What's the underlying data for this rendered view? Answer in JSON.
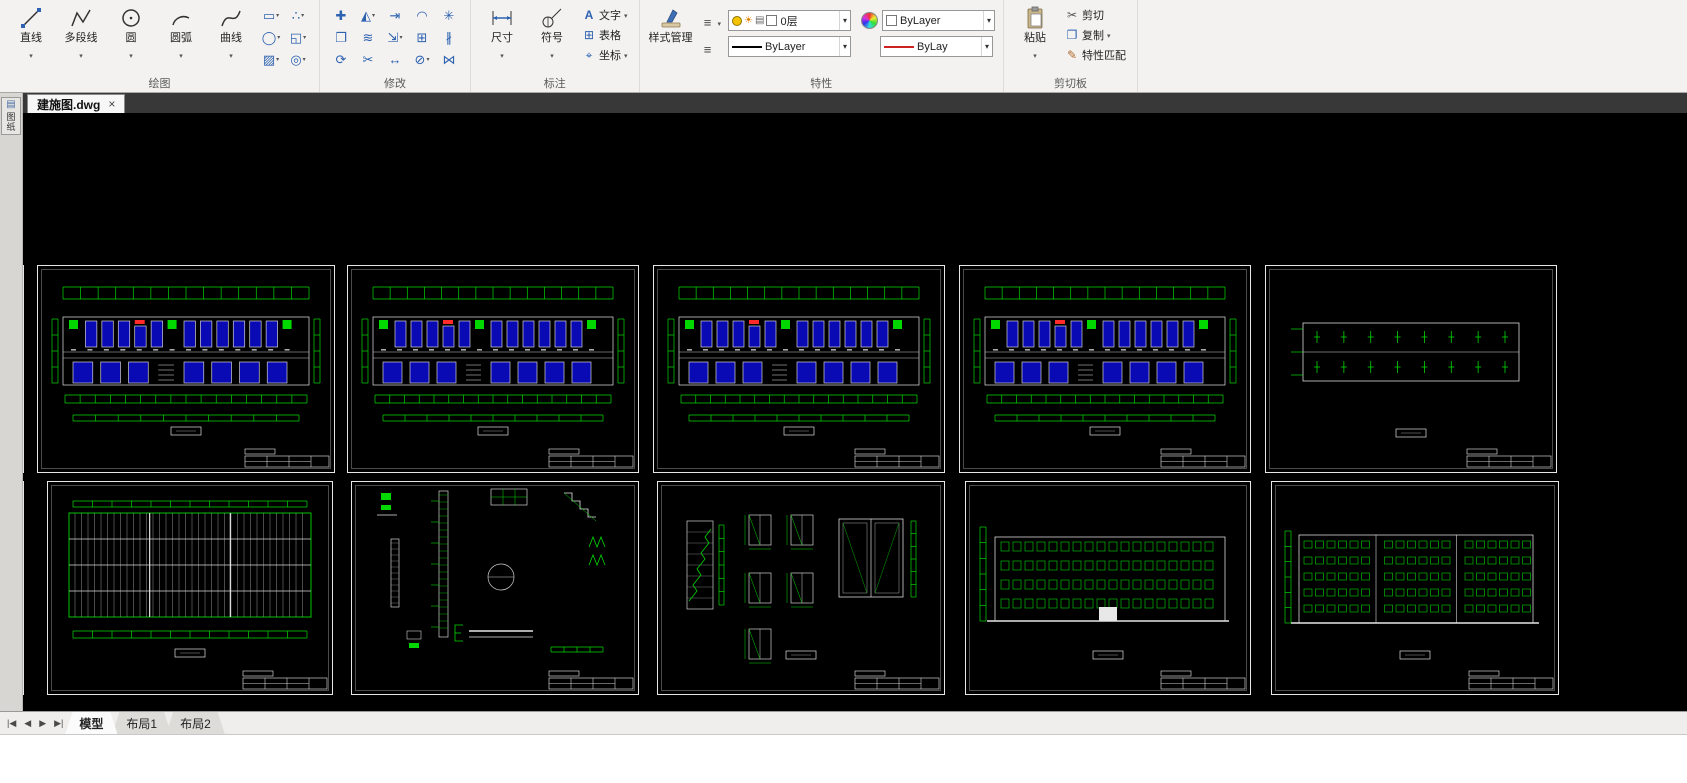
{
  "colors": {
    "cad_green": "#00d800",
    "cad_blue": "#0a0ab4",
    "cad_red": "#ff2a2a",
    "frame_white": "#e6e6e6"
  },
  "ribbon": {
    "draw": {
      "label": "绘图",
      "tools": [
        {
          "label": "直线"
        },
        {
          "label": "多段线"
        },
        {
          "label": "圆"
        },
        {
          "label": "圆弧"
        },
        {
          "label": "曲线"
        }
      ],
      "small_icons": [
        "rectangle",
        "ellipse",
        "hatch",
        "point",
        "region",
        "donut"
      ]
    },
    "modify": {
      "label": "修改",
      "icons": [
        "move",
        "copy",
        "rotate",
        "mirror",
        "offset",
        "trim",
        "extend",
        "scale",
        "stretch",
        "fillet",
        "array",
        "erase",
        "explode",
        "break",
        "join"
      ]
    },
    "annotate": {
      "label": "标注",
      "dimension": "尺寸",
      "symbol": "符号",
      "text": "文字",
      "table": "表格",
      "coordinate": "坐标"
    },
    "properties": {
      "label": "特性",
      "style_manager": "样式管理",
      "layer": "0层",
      "layer_icons": [
        "bulb",
        "sun",
        "printer",
        "swatch"
      ],
      "color": "ByLayer",
      "linetype": "ByLayer",
      "lineweight": "ByLay"
    },
    "clipboard": {
      "label": "剪切板",
      "paste": "粘贴",
      "cut": "剪切",
      "copy": "复制",
      "match_properties": "特性匹配"
    }
  },
  "file_tab": {
    "name": "建施图.dwg",
    "close": "×"
  },
  "side_palette": {
    "chars": "图纸"
  },
  "layout_bar": {
    "nav": [
      "|◀",
      "◀",
      "▶",
      "▶|"
    ],
    "tabs": [
      "模型",
      "布局1",
      "布局2"
    ],
    "active_index": 0
  },
  "canvas": {
    "sheets": [
      {
        "type": "floor-plan",
        "name": "floor-plan-1"
      },
      {
        "type": "floor-plan",
        "name": "floor-plan-2"
      },
      {
        "type": "floor-plan",
        "name": "floor-plan-3"
      },
      {
        "type": "floor-plan",
        "name": "floor-plan-4"
      },
      {
        "type": "roof-plan",
        "name": "roof-plan"
      },
      {
        "type": "grid-plan",
        "name": "roof-framing-plan"
      },
      {
        "type": "detail-sheet",
        "name": "wall-details"
      },
      {
        "type": "door-detail-sheet",
        "name": "door-stair-details"
      },
      {
        "type": "elevation",
        "name": "elevation-1"
      },
      {
        "type": "elevation-2",
        "name": "elevation-2"
      }
    ]
  }
}
